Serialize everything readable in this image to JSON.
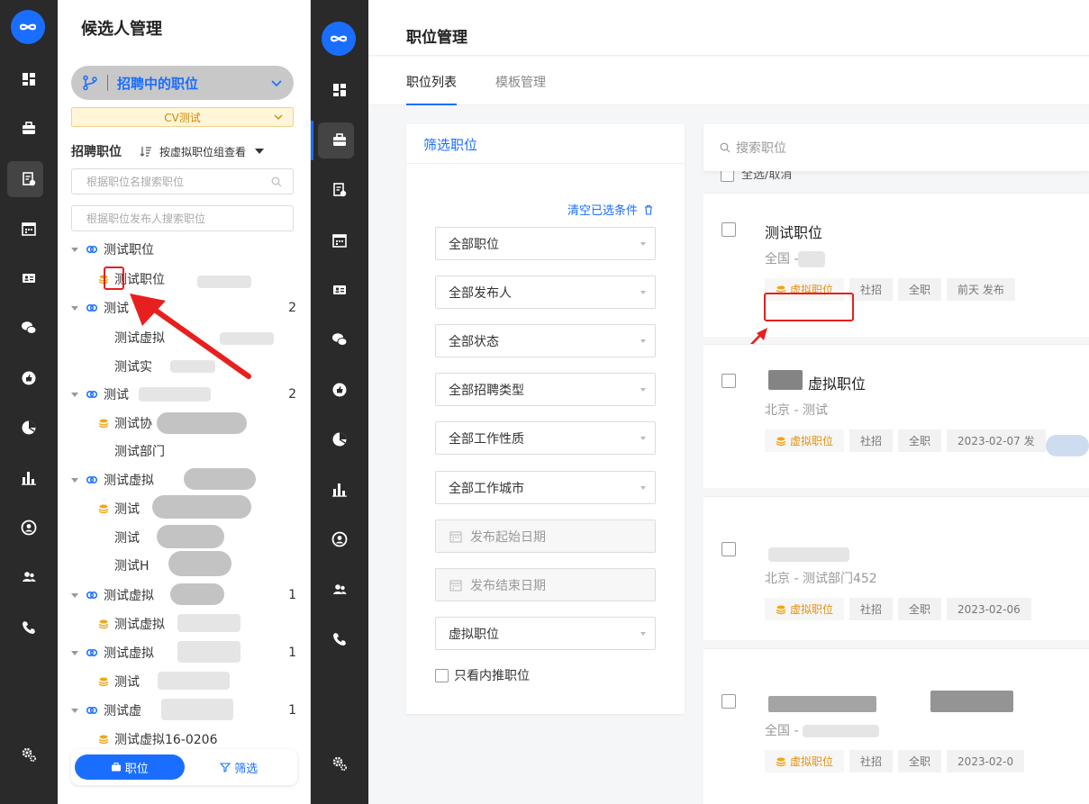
{
  "left_app": {
    "title": "候选人管理",
    "position_selector": "招聘中的职位",
    "cv_filter": "CV测试",
    "jobs_label": "招聘职位",
    "group_view": "按虚拟职位组查看",
    "search_by_name_placeholder": "根据职位名搜索职位",
    "search_by_publisher_placeholder": "根据职位发布人搜索职位",
    "tree": [
      {
        "type": "group",
        "label": "测试职位",
        "count": ""
      },
      {
        "type": "virtual",
        "label": "测试职位"
      },
      {
        "type": "group",
        "label": "测试",
        "count": "2"
      },
      {
        "type": "child",
        "label": "测试虚拟"
      },
      {
        "type": "child",
        "label": "测试实"
      },
      {
        "type": "group",
        "label": "测试",
        "count": "2"
      },
      {
        "type": "virtual",
        "label": "测试协"
      },
      {
        "type": "child",
        "label": "测试部门"
      },
      {
        "type": "group",
        "label": "测试虚拟",
        "count": ""
      },
      {
        "type": "virtual",
        "label": "测试"
      },
      {
        "type": "child",
        "label": "测试"
      },
      {
        "type": "child",
        "label": "测试H"
      },
      {
        "type": "group",
        "label": "测试虚拟",
        "count": "1"
      },
      {
        "type": "virtual",
        "label": "测试虚拟"
      },
      {
        "type": "group",
        "label": "测试虚拟",
        "count": "1"
      },
      {
        "type": "virtual",
        "label": "测试"
      },
      {
        "type": "group",
        "label": "测试虚",
        "count": "1"
      },
      {
        "type": "virtual",
        "label": "测试虚拟16-0206"
      }
    ],
    "bottom_tabs": {
      "jobs": "职位",
      "filter": "筛选"
    }
  },
  "right_app": {
    "title": "职位管理",
    "tabs": [
      "职位列表",
      "模板管理"
    ],
    "filter_title": "筛选职位",
    "clear_label": "清空已选条件",
    "dropdowns": [
      "全部职位",
      "全部发布人",
      "全部状态",
      "全部招聘类型",
      "全部工作性质",
      "全部工作城市"
    ],
    "date_start": "发布起始日期",
    "date_end": "发布结束日期",
    "virtual_dropdown": "虚拟职位",
    "referral_only": "只看内推职位",
    "search_placeholder": "搜索职位",
    "select_all": "全选/取消",
    "jobs": [
      {
        "title": "测试职位",
        "location": "全国 -",
        "tags": [
          "虚拟职位",
          "社招",
          "全职",
          "前天 发布"
        ]
      },
      {
        "title": "虚拟职位",
        "location": "北京 - 测试",
        "tags": [
          "虚拟职位",
          "社招",
          "全职",
          "2023-02-07 发"
        ]
      },
      {
        "title": "",
        "location": "北京 - 测试部门452",
        "tags": [
          "虚拟职位",
          "社招",
          "全职",
          "2023-02-06"
        ]
      },
      {
        "title": "",
        "location": "全国 -",
        "tags": [
          "虚拟职位",
          "社招",
          "全职",
          "2023-02-0"
        ]
      }
    ]
  }
}
